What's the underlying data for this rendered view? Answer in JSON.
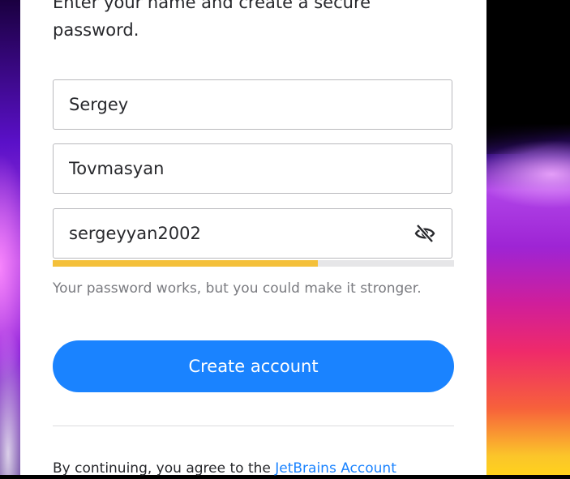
{
  "background": {
    "left_colors": [
      "#5a10c8",
      "#b040e0"
    ],
    "right_colors": [
      "#000000",
      "#b044e8",
      "#ef2a6a",
      "#ffd21d"
    ]
  },
  "form": {
    "intro": "Enter your name and create a secure password.",
    "first_name_value": "Sergey",
    "last_name_value": "Tovmasyan",
    "password_value": "sergeyyan2002",
    "password_visibility_icon": "eye-slash-icon",
    "strength": {
      "level": 0.66,
      "color": "#f4c03a",
      "track_color": "#e6e6e8"
    },
    "strength_hint": "Your password works, but you could make it stronger.",
    "submit_label": "Create account",
    "submit_color": "#1a83ff"
  },
  "legal": {
    "text": "By continuing, you agree to the ",
    "link": "JetBrains Account"
  }
}
